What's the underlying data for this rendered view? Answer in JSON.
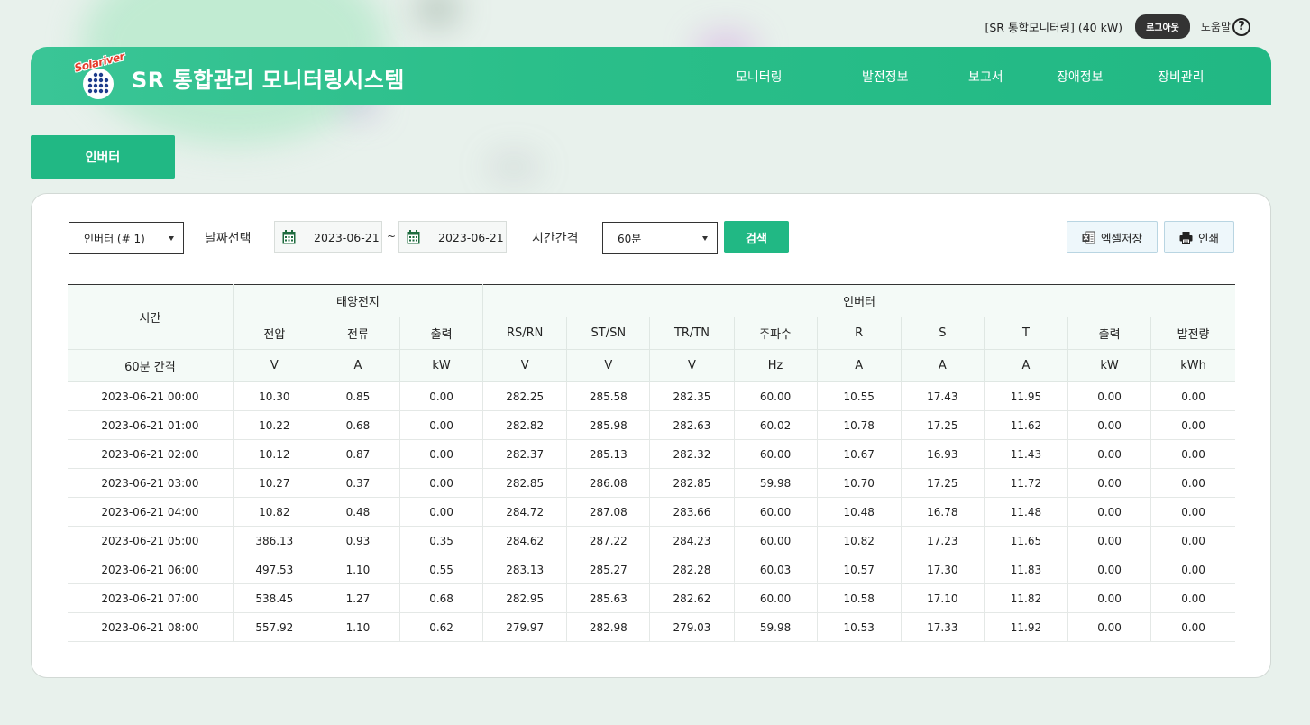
{
  "topbar": {
    "user_info": "[SR 통합모니터링]  (40 kW)",
    "logout_label": "로그아웃",
    "help_label": "도움말",
    "help_icon": "?"
  },
  "header": {
    "logo_text": "Solariver",
    "title": "SR 통합관리 모니터링시스템",
    "nav": [
      "모니터링",
      "발전정보",
      "보고서",
      "장애정보",
      "장비관리"
    ]
  },
  "section_tab": "인버터",
  "filters": {
    "inverter_select": "인버터 (# 1)",
    "date_label": "날짜선택",
    "date_from": "2023-06-21",
    "date_separator": "~",
    "date_to": "2023-06-21",
    "interval_label": "시간간격",
    "interval_select": "60분",
    "search_label": "검색",
    "excel_label": "엑셀저장",
    "print_label": "인쇄"
  },
  "colors": {
    "accent": "#21b884",
    "header_gradient_start": "#3ac596",
    "background": "#e8f1ec"
  },
  "table": {
    "group_time": "시간",
    "group_solar": "태양전지",
    "group_inverter": "인버터",
    "columns": [
      "전압",
      "전류",
      "출력",
      "RS/RN",
      "ST/SN",
      "TR/TN",
      "주파수",
      "R",
      "S",
      "T",
      "출력",
      "발전량"
    ],
    "interval_label": "60분 간격",
    "units": [
      "V",
      "A",
      "kW",
      "V",
      "V",
      "V",
      "Hz",
      "A",
      "A",
      "A",
      "kW",
      "kWh"
    ],
    "rows": [
      [
        "2023-06-21 00:00",
        "10.30",
        "0.85",
        "0.00",
        "282.25",
        "285.58",
        "282.35",
        "60.00",
        "10.55",
        "17.43",
        "11.95",
        "0.00",
        "0.00"
      ],
      [
        "2023-06-21 01:00",
        "10.22",
        "0.68",
        "0.00",
        "282.82",
        "285.98",
        "282.63",
        "60.02",
        "10.78",
        "17.25",
        "11.62",
        "0.00",
        "0.00"
      ],
      [
        "2023-06-21 02:00",
        "10.12",
        "0.87",
        "0.00",
        "282.37",
        "285.13",
        "282.32",
        "60.00",
        "10.67",
        "16.93",
        "11.43",
        "0.00",
        "0.00"
      ],
      [
        "2023-06-21 03:00",
        "10.27",
        "0.37",
        "0.00",
        "282.85",
        "286.08",
        "282.85",
        "59.98",
        "10.70",
        "17.25",
        "11.72",
        "0.00",
        "0.00"
      ],
      [
        "2023-06-21 04:00",
        "10.82",
        "0.48",
        "0.00",
        "284.72",
        "287.08",
        "283.66",
        "60.00",
        "10.48",
        "16.78",
        "11.48",
        "0.00",
        "0.00"
      ],
      [
        "2023-06-21 05:00",
        "386.13",
        "0.93",
        "0.35",
        "284.62",
        "287.22",
        "284.23",
        "60.00",
        "10.82",
        "17.23",
        "11.65",
        "0.00",
        "0.00"
      ],
      [
        "2023-06-21 06:00",
        "497.53",
        "1.10",
        "0.55",
        "283.13",
        "285.27",
        "282.28",
        "60.03",
        "10.57",
        "17.30",
        "11.83",
        "0.00",
        "0.00"
      ],
      [
        "2023-06-21 07:00",
        "538.45",
        "1.27",
        "0.68",
        "282.95",
        "285.63",
        "282.62",
        "60.00",
        "10.58",
        "17.10",
        "11.82",
        "0.00",
        "0.00"
      ],
      [
        "2023-06-21 08:00",
        "557.92",
        "1.10",
        "0.62",
        "279.97",
        "282.98",
        "279.03",
        "59.98",
        "10.53",
        "17.33",
        "11.92",
        "0.00",
        "0.00"
      ]
    ]
  }
}
